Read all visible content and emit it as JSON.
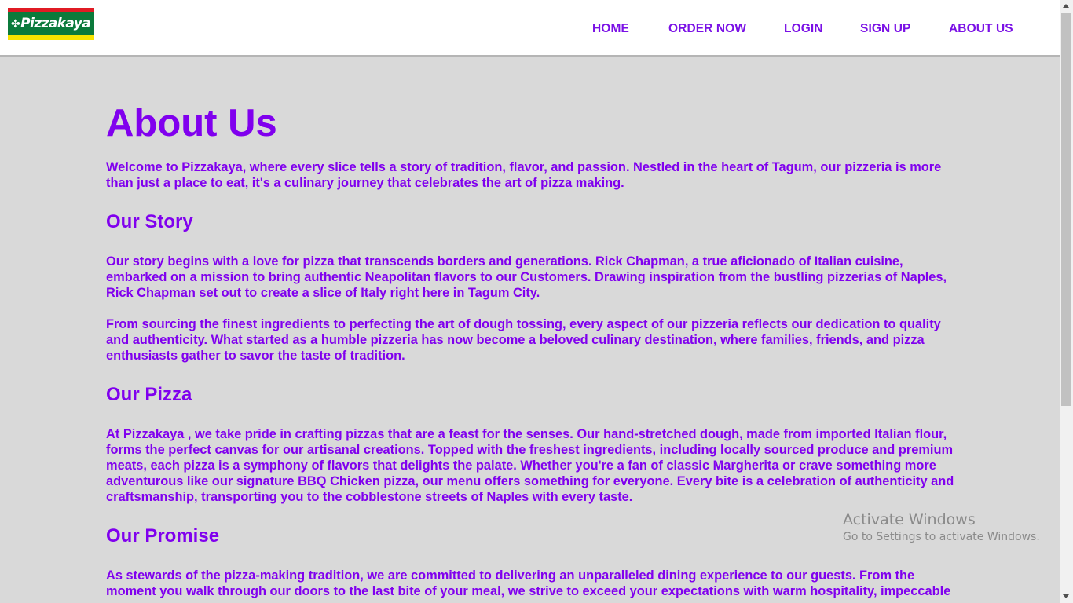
{
  "header": {
    "logo_text": "Pizzakaya",
    "logo_leaf_icon": "clover-icon",
    "nav": [
      {
        "label": "HOME"
      },
      {
        "label": "ORDER NOW"
      },
      {
        "label": "LOGIN"
      },
      {
        "label": "SIGN UP"
      },
      {
        "label": "ABOUT US"
      }
    ]
  },
  "colors": {
    "accent": "#8000ee",
    "page_bg": "#d9d9d9",
    "logo_green": "#0b7a3b",
    "logo_red": "#e01b24",
    "logo_yellow": "#f7e300"
  },
  "main": {
    "title": "About Us",
    "intro_lines": [
      "Welcome to Pizzakaya, where every slice tells a story of tradition, flavor, and passion. Nestled in the heart of Tagum, our pizzeria is more",
      "than just a place to eat, it's a culinary journey that celebrates the art of pizza making."
    ],
    "story_heading": "Our Story",
    "story_p1_lines": [
      "Our story begins with a love for pizza that transcends borders and generations. Rick Chapman, a true aficionado of Italian cuisine,",
      "embarked on a mission to bring authentic Neapolitan flavors to our Customers. Drawing inspiration from the bustling pizzerias of Naples,",
      "Rick Chapman set out to create a slice of Italy right here in Tagum City."
    ],
    "story_p2_lines": [
      "From sourcing the finest ingredients to perfecting the art of dough tossing, every aspect of our pizzeria reflects our dedication to quality",
      "and authenticity. What started as a humble pizzeria has now become a beloved culinary destination, where families, friends, and pizza",
      "enthusiasts gather to savor the taste of tradition."
    ],
    "pizza_heading": "Our Pizza",
    "pizza_lines": [
      "At Pizzakaya , we take pride in crafting pizzas that are a feast for the senses. Our hand-stretched dough, made from imported Italian flour,",
      "forms the perfect canvas for our artisanal creations. Topped with the freshest ingredients, including locally sourced produce and premium",
      "meats, each pizza is a symphony of flavors that delights the palate. Whether you're a fan of classic Margherita or crave something more",
      "adventurous like our signature BBQ Chicken pizza, our menu offers something for everyone. Every bite is a celebration of authenticity and",
      "craftsmanship, transporting you to the cobblestone streets of Naples with every taste."
    ],
    "promise_heading": "Our Promise",
    "promise_lines": [
      "As stewards of the pizza-making tradition, we are committed to delivering an unparalleled dining experience to our guests. From the",
      "moment you walk through our doors to the last bite of your meal, we strive to exceed your expectations with warm hospitality, impeccable"
    ]
  },
  "watermark": {
    "title": "Activate Windows",
    "subtitle": "Go to Settings to activate Windows."
  }
}
